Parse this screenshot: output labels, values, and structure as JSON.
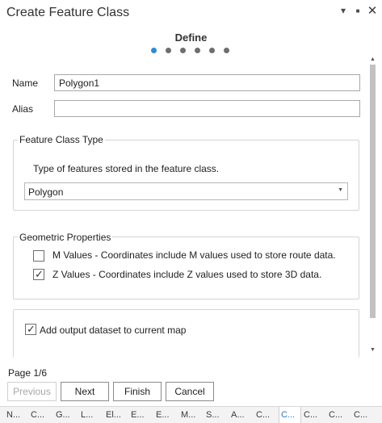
{
  "window": {
    "title": "Create Feature Class",
    "minimize_glyph": "▾",
    "pin_glyph": "■",
    "close_glyph": "✕"
  },
  "wizard": {
    "step_title": "Define",
    "total_steps": 6,
    "current_step": 1,
    "page_label": "Page 1/6"
  },
  "fields": {
    "name_label": "Name",
    "name_value": "Polygon1",
    "alias_label": "Alias",
    "alias_value": ""
  },
  "feature_class_type": {
    "legend": "Feature Class Type",
    "description": "Type of features stored in the feature class.",
    "selected": "Polygon"
  },
  "geometric_properties": {
    "legend": "Geometric Properties",
    "m_values": {
      "label": "M Values - Coordinates include M values used to store route data.",
      "checked": false
    },
    "z_values": {
      "label": "Z Values - Coordinates include Z values used to store 3D data.",
      "checked": true
    }
  },
  "output": {
    "add_to_map": {
      "label": "Add output dataset to current map",
      "checked": true
    }
  },
  "buttons": {
    "previous": "Previous",
    "next": "Next",
    "finish": "Finish",
    "cancel": "Cancel"
  },
  "bottom_tabs": [
    "N...",
    "C...",
    "G...",
    "L...",
    "El...",
    "E...",
    "E...",
    "M...",
    "S...",
    "A...",
    "C...",
    "C...",
    "C...",
    "C...",
    "C..."
  ],
  "bottom_tabs_active_index": 11,
  "colors": {
    "accent": "#2b8bd6",
    "dot_inactive": "#6e6e6e"
  }
}
